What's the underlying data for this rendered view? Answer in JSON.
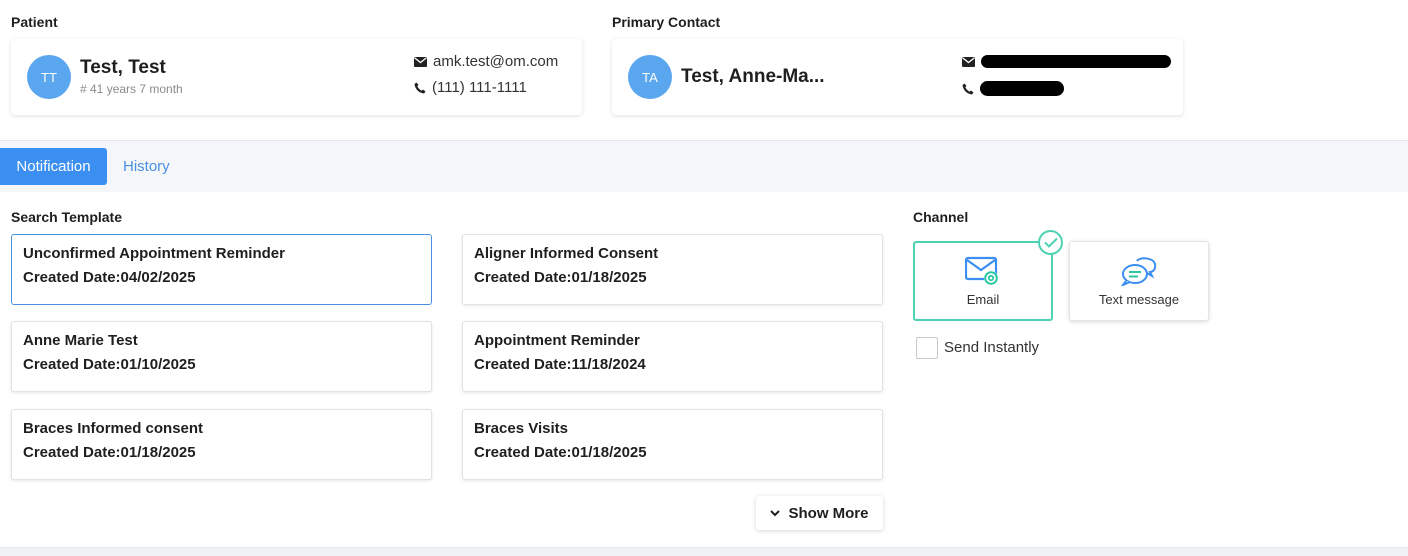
{
  "patient": {
    "section_label": "Patient",
    "initials": "TT",
    "name": "Test, Test",
    "age": "# 41 years 7 month",
    "email": "amk.test@om.com",
    "phone": "(111) 111-1111"
  },
  "primary_contact": {
    "section_label": "Primary Contact",
    "initials": "TA",
    "name": "Test, Anne-Ma..."
  },
  "tabs": [
    {
      "label": "Notification",
      "active": true
    },
    {
      "label": "History",
      "active": false
    }
  ],
  "search_template": {
    "label": "Search Template",
    "templates": [
      {
        "name": "Unconfirmed Appointment Reminder",
        "date": "Created Date:04/02/2025",
        "selected": true
      },
      {
        "name": "Aligner Informed Consent",
        "date": "Created Date:01/18/2025",
        "selected": false
      },
      {
        "name": "Anne Marie Test",
        "date": "Created Date:01/10/2025",
        "selected": false
      },
      {
        "name": "Appointment Reminder",
        "date": "Created Date:11/18/2024",
        "selected": false
      },
      {
        "name": "Braces Informed consent",
        "date": "Created Date:01/18/2025",
        "selected": false
      },
      {
        "name": "Braces Visits",
        "date": "Created Date:01/18/2025",
        "selected": false
      }
    ],
    "show_more_label": "Show More"
  },
  "channel": {
    "label": "Channel",
    "options": [
      {
        "label": "Email",
        "icon": "email-icon",
        "selected": true
      },
      {
        "label": "Text message",
        "icon": "chat-bubbles-icon",
        "selected": false
      }
    ],
    "send_instantly_label": "Send Instantly",
    "send_instantly_checked": false
  },
  "colors": {
    "accent": "#3b8ff0",
    "avatar": "#5aa6ef",
    "selected_channel": "#4fd1b4"
  }
}
